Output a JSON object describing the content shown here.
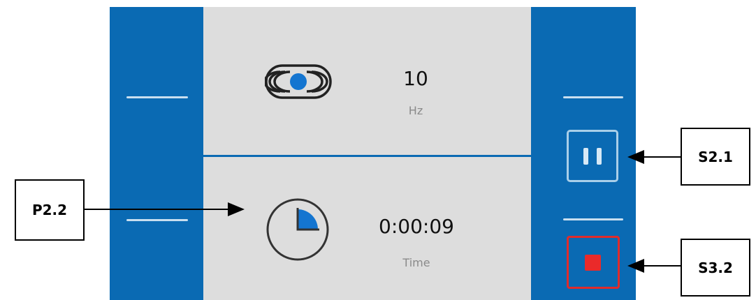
{
  "frequency": {
    "value": "10",
    "unit": "Hz"
  },
  "timer": {
    "value": "0:00:09",
    "unit": "Time"
  },
  "annotations": {
    "p2_2": "P2.2",
    "s2_1": "S2.1",
    "s3_2": "S3.2"
  },
  "icons": {
    "frequency": "vibration-icon",
    "timer": "clock-icon",
    "pause": "pause-icon",
    "stop": "stop-icon"
  },
  "colors": {
    "panel_blue": "#0a6ab3",
    "screen_gray": "#dddddd",
    "stop_red": "#ea2a2a",
    "pause_outline": "#a9cfe9",
    "accent_blue": "#1475d0"
  }
}
